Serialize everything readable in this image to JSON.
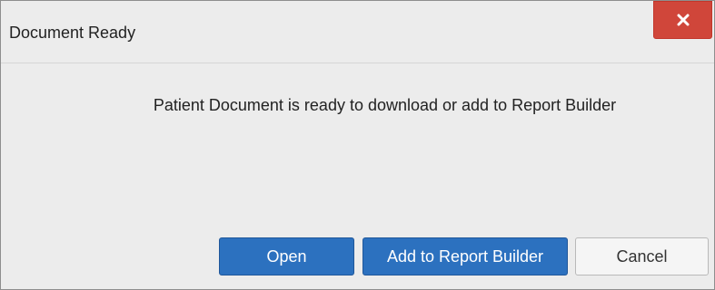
{
  "dialog": {
    "title": "Document Ready",
    "close_icon": "close-icon",
    "message": "Patient Document is ready to download or add to Report Builder",
    "buttons": {
      "open_label": "Open",
      "add_label": "Add to Report Builder",
      "cancel_label": "Cancel"
    }
  },
  "colors": {
    "close_button": "#d0463a",
    "primary_button": "#2c71bf",
    "dialog_background": "#ececec"
  }
}
